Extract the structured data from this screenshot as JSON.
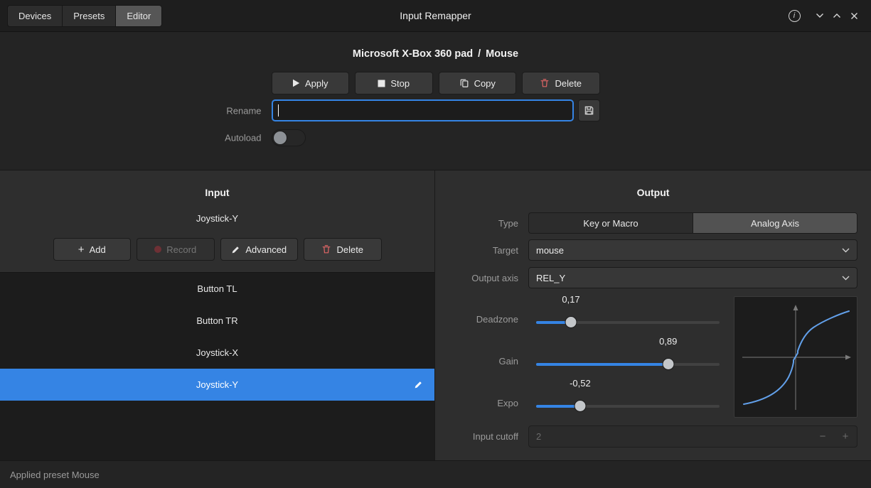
{
  "colors": {
    "accent": "#3584e4",
    "curve": "#62a0ea",
    "danger": "#e06565",
    "selected_row": "#3584e4"
  },
  "icons": {
    "play": "▶",
    "stop": "■",
    "copy": "copy-shape",
    "trash": "trash-shape",
    "save": "floppy-shape",
    "add": "+",
    "record": "●",
    "pencil": "pencil-shape",
    "chevron_down": "⌄",
    "chevron_up": "⌃",
    "close": "×",
    "info": "i"
  },
  "titlebar": {
    "title": "Input Remapper",
    "info_glyph": "i",
    "tabs": [
      {
        "label": "Devices",
        "active": false
      },
      {
        "label": "Presets",
        "active": false
      },
      {
        "label": "Editor",
        "active": true
      }
    ]
  },
  "header": {
    "device_name": "Microsoft X-Box 360 pad",
    "separator": "/",
    "preset_name": "Mouse",
    "apply_label": "Apply",
    "stop_label": "Stop",
    "copy_label": "Copy",
    "delete_label": "Delete",
    "rename_label": "Rename",
    "rename_value": "",
    "autoload_label": "Autoload",
    "autoload_on": false
  },
  "input_panel": {
    "title": "Input",
    "current_input": "Joystick-Y",
    "add_label": "Add",
    "record_label": "Record",
    "advanced_label": "Advanced",
    "delete_label": "Delete",
    "list": [
      {
        "label": "Button TL",
        "selected": false
      },
      {
        "label": "Button TR",
        "selected": false
      },
      {
        "label": "Joystick-X",
        "selected": false
      },
      {
        "label": "Joystick-Y",
        "selected": true
      }
    ]
  },
  "output_panel": {
    "title": "Output",
    "type_label": "Type",
    "type_options": [
      {
        "label": "Key or Macro",
        "selected": false
      },
      {
        "label": "Analog Axis",
        "selected": true
      }
    ],
    "target_label": "Target",
    "target_value": "mouse",
    "output_axis_label": "Output axis",
    "output_axis_value": "REL_Y",
    "sliders": [
      {
        "label": "Deadzone",
        "value": "0,17",
        "fraction": 0.19
      },
      {
        "label": "Gain",
        "value": "0,89",
        "fraction": 0.72
      },
      {
        "label": "Expo",
        "value": "-0,52",
        "fraction": 0.24
      }
    ],
    "input_cutoff_label": "Input cutoff",
    "input_cutoff_value": "2",
    "spin_minus": "−",
    "spin_plus": "+"
  },
  "statusbar": {
    "message": "Applied preset Mouse"
  }
}
